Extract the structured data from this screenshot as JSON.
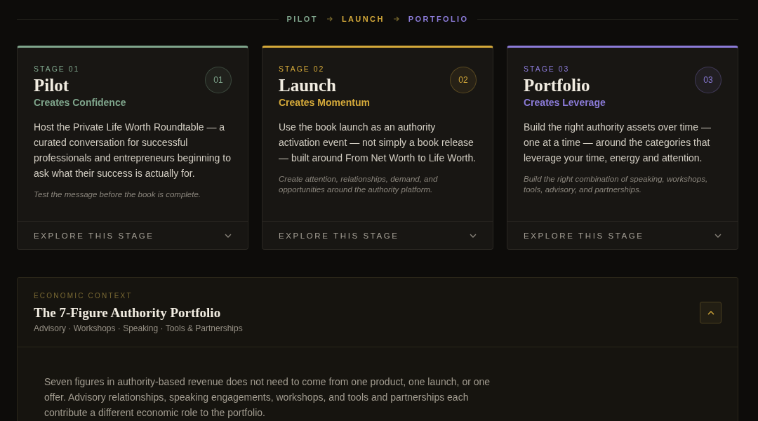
{
  "breadcrumb": [
    {
      "label": "PILOT",
      "color": "#7fa58c"
    },
    {
      "label": "LAUNCH",
      "color": "#d4a93a"
    },
    {
      "label": "PORTFOLIO",
      "color": "#8b7bd8"
    }
  ],
  "stages": [
    {
      "stage": "STAGE 01",
      "number": "01",
      "title": "Pilot",
      "subtitle": "Creates Confidence",
      "color": "#7fa58c",
      "body": "Host the Private Life Worth Roundtable — a curated conversation for successful professionals and entrepreneurs beginning to ask what their success is actually for.",
      "note": "Test the message before the book is complete.",
      "footer": "EXPLORE THIS STAGE",
      "expanded": false
    },
    {
      "stage": "STAGE 02",
      "number": "02",
      "title": "Launch",
      "subtitle": "Creates Momentum",
      "color": "#d4a93a",
      "body": "Use the book launch as an authority activation event — not simply a book release — built around From Net Worth to Life Worth.",
      "note": "Create attention, relationships, demand, and opportunities around the authority platform.",
      "footer": "EXPLORE THIS STAGE",
      "expanded": false
    },
    {
      "stage": "STAGE 03",
      "number": "03",
      "title": "Portfolio",
      "subtitle": "Creates Leverage",
      "color": "#8b7bd8",
      "body": "Build the right authority assets over time — one at a time — around the categories that leverage your time, energy and attention.",
      "note": "Build the right combination of speaking, workshops, tools, advisory, and partnerships.",
      "footer": "EXPLORE THIS STAGE",
      "expanded": false
    }
  ],
  "context": {
    "eyebrow": "ECONOMIC CONTEXT",
    "title": "The 7-Figure Authority Portfolio",
    "subtitle": "Advisory · Workshops · Speaking · Tools & Partnerships",
    "expanded": true,
    "body": "Seven figures in authority-based revenue does not need to come from one product, one launch, or one offer. Advisory relationships, speaking engagements, workshops, and tools and partnerships each contribute a different economic role to the portfolio."
  }
}
